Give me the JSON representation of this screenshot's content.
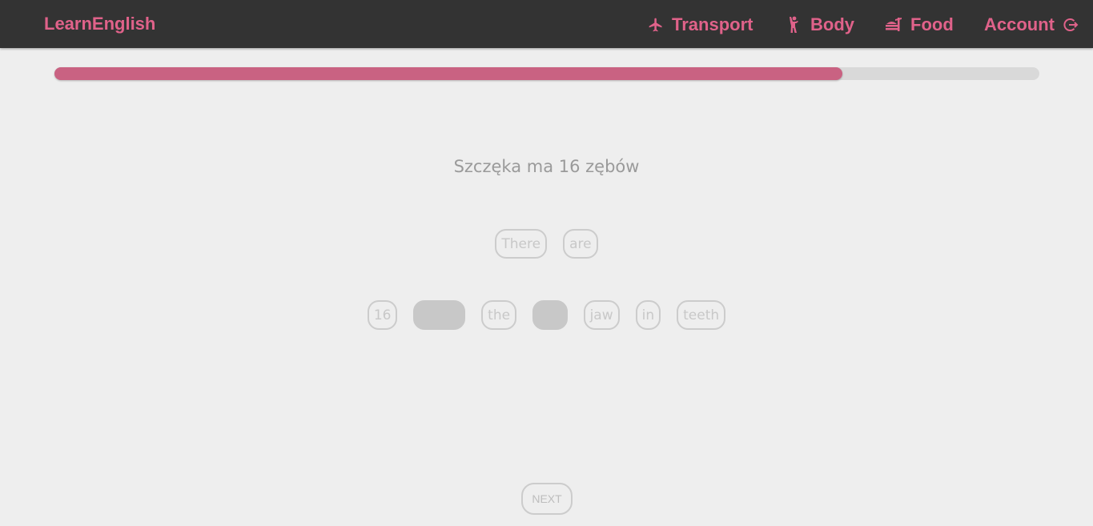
{
  "nav": {
    "brand": "LearnEnglish",
    "items": [
      {
        "label": "Transport",
        "icon": "airplane-icon"
      },
      {
        "label": "Body",
        "icon": "person-icon"
      },
      {
        "label": "Food",
        "icon": "food-icon"
      },
      {
        "label": "Account",
        "icon": "logout-icon"
      }
    ]
  },
  "colors": {
    "accent": "#e0628a",
    "progress_fill": "#c96282",
    "navbar_bg": "#333333",
    "page_bg": "#eeeeee"
  },
  "progress": {
    "fraction": 0.8
  },
  "exercise": {
    "prompt": "Szczęka ma 16 zębów",
    "answer_words": [
      "There",
      "are"
    ],
    "word_bank": [
      {
        "word": "16",
        "used": false
      },
      {
        "word": "There",
        "used": true
      },
      {
        "word": "the",
        "used": false
      },
      {
        "word": "are",
        "used": true
      },
      {
        "word": "jaw",
        "used": false
      },
      {
        "word": "in",
        "used": false
      },
      {
        "word": "teeth",
        "used": false
      }
    ]
  },
  "next_label": "NEXT"
}
